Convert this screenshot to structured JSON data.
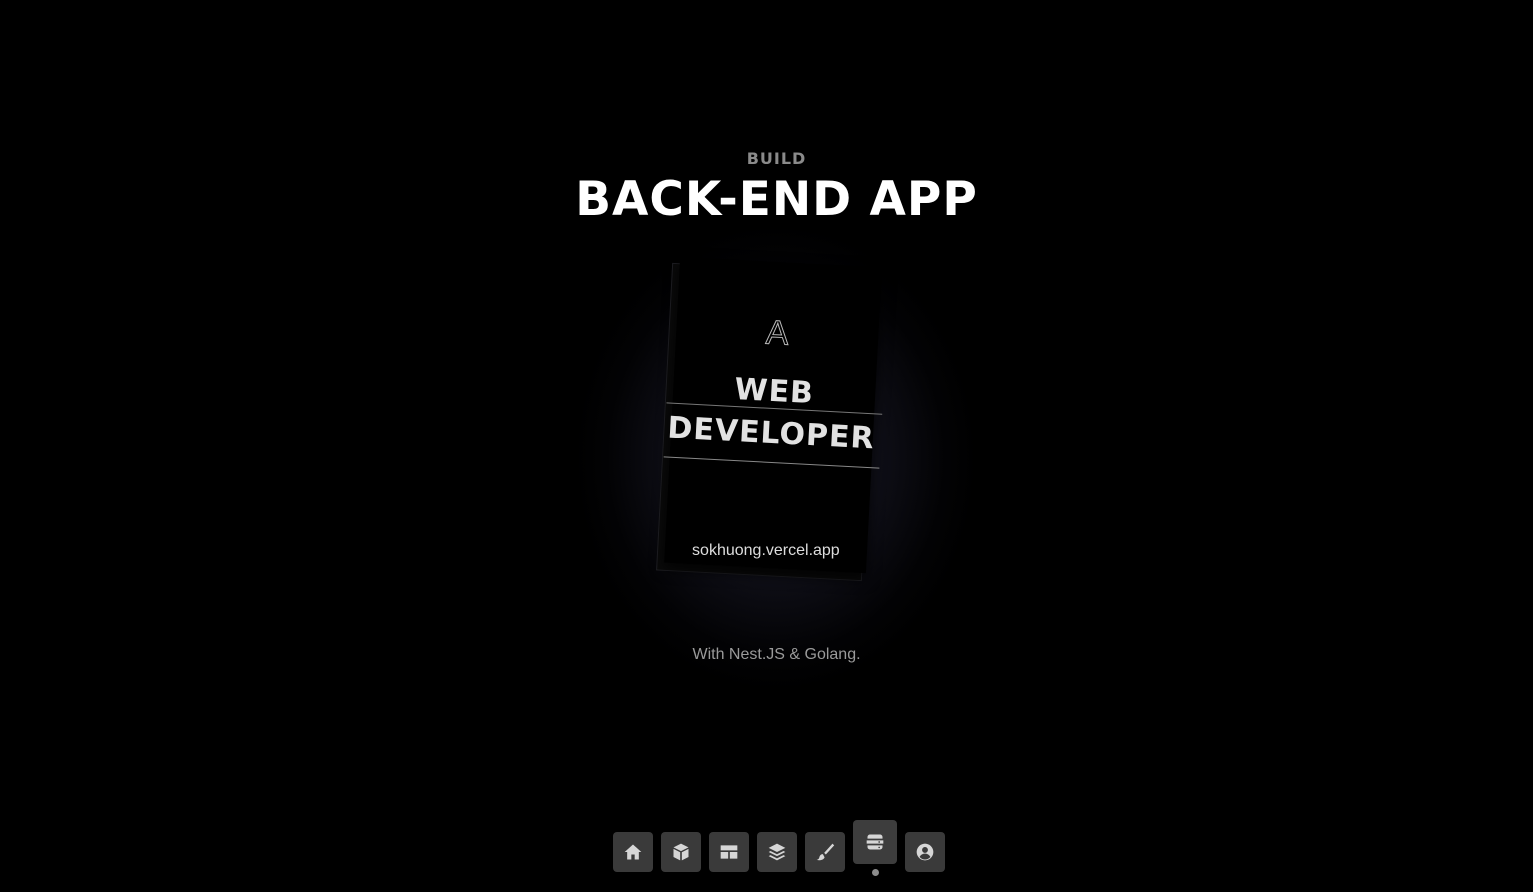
{
  "hero": {
    "eyebrow": "BUILD",
    "headline": "BACK-END APP",
    "caption": "With Nest.JS & Golang."
  },
  "card": {
    "logo": "A",
    "title_line1": "WEB",
    "title_line2": "DEVELOPER",
    "url": "sokhuong.vercel.app"
  },
  "dock": {
    "items": [
      {
        "icon": "home-icon",
        "active": false
      },
      {
        "icon": "cube-icon",
        "active": false
      },
      {
        "icon": "layout-icon",
        "active": false
      },
      {
        "icon": "layers-icon",
        "active": false
      },
      {
        "icon": "paintbrush-icon",
        "active": false
      },
      {
        "icon": "server-icon",
        "active": true
      },
      {
        "icon": "user-circle-icon",
        "active": false
      }
    ]
  },
  "colors": {
    "background": "#000000",
    "dock_button": "#3a3a3a",
    "text_primary": "#ffffff",
    "text_muted": "#8a8a8a"
  }
}
